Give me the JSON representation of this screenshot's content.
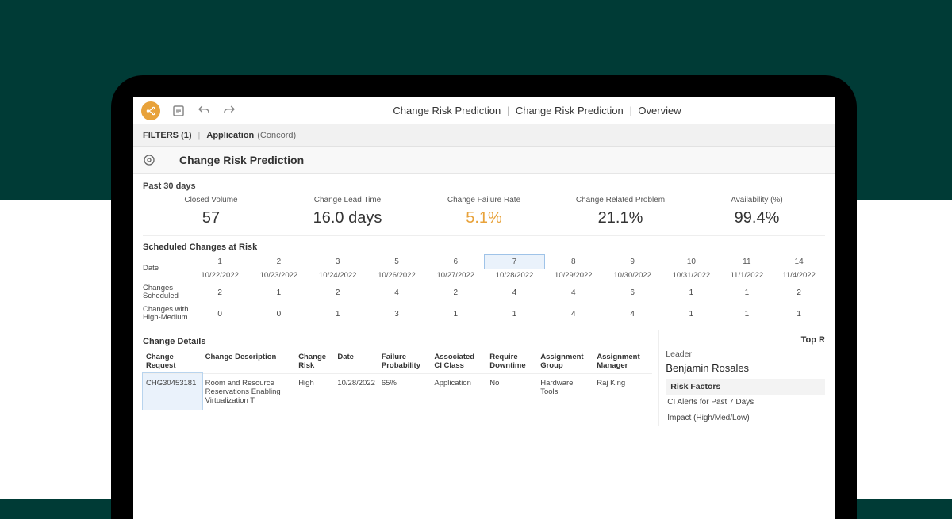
{
  "breadcrumb": {
    "a": "Change Risk Prediction",
    "b": "Change Risk Prediction",
    "c": "Overview"
  },
  "filters": {
    "label": "FILTERS (1)",
    "app_label": "Application",
    "app_value": "(Concord)"
  },
  "page_title": "Change Risk Prediction",
  "period_label": "Past 30 days",
  "kpis": [
    {
      "label": "Closed Volume",
      "value": "57"
    },
    {
      "label": "Change Lead Time",
      "value": "16.0 days"
    },
    {
      "label": "Change Failure Rate",
      "value": "5.1%",
      "accent": true
    },
    {
      "label": "Change Related Problem",
      "value": "21.1%"
    },
    {
      "label": "Availability (%)",
      "value": "99.4%"
    }
  ],
  "sched_title": "Scheduled Changes at Risk",
  "sched": {
    "row_date": "Date",
    "nums": [
      "1",
      "2",
      "3",
      "5",
      "6",
      "7",
      "8",
      "9",
      "10",
      "11",
      "14"
    ],
    "dates": [
      "10/22/2022",
      "10/23/2022",
      "10/24/2022",
      "10/26/2022",
      "10/27/2022",
      "10/28/2022",
      "10/29/2022",
      "10/30/2022",
      "10/31/2022",
      "11/1/2022",
      "11/4/2022"
    ],
    "highlight_index": 5,
    "rows": [
      {
        "label": "Changes Scheduled",
        "vals": [
          "2",
          "1",
          "2",
          "4",
          "2",
          "4",
          "4",
          "6",
          "1",
          "1",
          "2"
        ]
      },
      {
        "label": "Changes with High-Medium",
        "vals": [
          "0",
          "0",
          "1",
          "3",
          "1",
          "1",
          "4",
          "4",
          "1",
          "1",
          "1"
        ]
      }
    ]
  },
  "details_title": "Change Details",
  "details_headers": [
    "Change Request",
    "Change Description",
    "Change Risk",
    "Date",
    "Failure Probability",
    "Associated CI Class",
    "Require Downtime",
    "Assignment Group",
    "Assignment Manager"
  ],
  "details_row": {
    "req": "CHG30453181",
    "desc": "Room and Resource Reservations Enabling Virtualization T",
    "risk": "High",
    "date": "10/28/2022",
    "prob": "65%",
    "ci": "Application",
    "down": "No",
    "grp": "Hardware Tools",
    "mgr": "Raj King"
  },
  "right": {
    "topr": "Top R",
    "leader_label": "Leader",
    "leader_value": "Benjamin Rosales",
    "factors_title": "Risk Factors",
    "factors": [
      "CI Alerts for Past 7 Days",
      "Impact (High/Med/Low)"
    ]
  }
}
